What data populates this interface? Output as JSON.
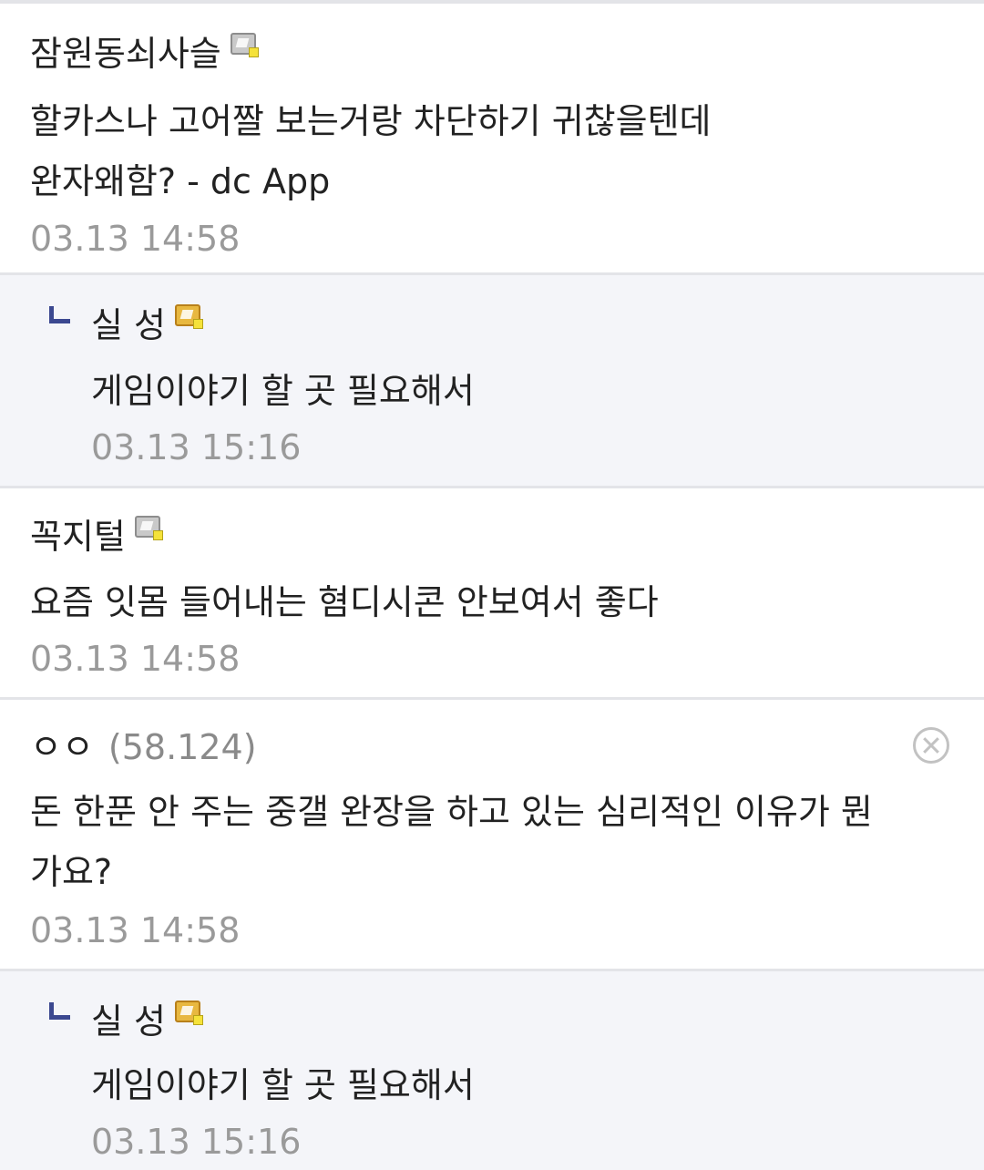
{
  "comments": [
    {
      "author": "잠원동쇠사슬",
      "author_icon": "fixed-nick-gallog-icon",
      "text_lines": [
        "할카스나 고어짤 보는거랑 차단하기 귀찮을텐데",
        "완자왜함? - dc App"
      ],
      "time": "03.13 14:58"
    },
    {
      "author": "실 성",
      "author_icon": "half-fixed-nick-gallog-icon",
      "is_reply": true,
      "text_lines": [
        "게임이야기 할 곳 필요해서"
      ],
      "time": "03.13 15:16"
    },
    {
      "author": "꼭지털",
      "author_icon": "fixed-nick-gallog-icon",
      "text_lines": [
        "요즘 잇몸 들어내는 혐디시콘 안보여서 좋다"
      ],
      "time": "03.13 14:58"
    },
    {
      "author": "ㅇㅇ",
      "ip": "(58.124)",
      "delete_icon": "close-circle-icon",
      "text_lines": [
        "돈 한푼 안 주는 중갤 완장을 하고 있는 심리적인 이유가 뭔",
        "가요?"
      ],
      "time": "03.13 14:58"
    },
    {
      "author": "실 성",
      "author_icon": "half-fixed-nick-gallog-icon",
      "is_reply": true,
      "text_lines": [
        "게임이야기 할 곳 필요해서"
      ],
      "time": "03.13 15:16"
    }
  ],
  "colors": {
    "divider": "#e3e4e8",
    "reply_background": "#f4f5f9",
    "reply_mark": "#3b4890",
    "timestamp": "#9a9a9a",
    "ip": "#8a8a8a"
  }
}
